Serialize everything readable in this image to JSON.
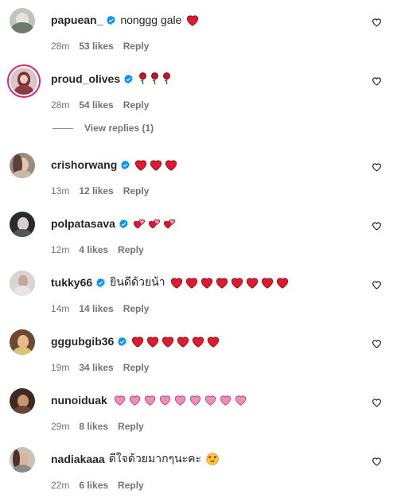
{
  "comments": [
    {
      "username": "papuean_",
      "verified": true,
      "text": "nonggg gale",
      "emoji": [
        {
          "type": "heart",
          "count": 1
        }
      ],
      "time": "28m",
      "likes": "53 likes",
      "reply": "Reply"
    },
    {
      "username": "proud_olives",
      "verified": true,
      "text": "",
      "emoji": [
        {
          "type": "rose",
          "count": 3
        }
      ],
      "time": "28m",
      "likes": "54 likes",
      "reply": "Reply",
      "story_ring": true,
      "view_replies": "View replies (1)"
    },
    {
      "username": "crishorwang",
      "verified": true,
      "text": "",
      "emoji": [
        {
          "type": "heart",
          "count": 3
        }
      ],
      "time": "13m",
      "likes": "12 likes",
      "reply": "Reply"
    },
    {
      "username": "polpatasava",
      "verified": true,
      "text": "",
      "emoji": [
        {
          "type": "two-hearts",
          "count": 3
        }
      ],
      "time": "12m",
      "likes": "4 likes",
      "reply": "Reply"
    },
    {
      "username": "tukky66",
      "verified": true,
      "text": "ยินดีด้วยน้า",
      "emoji": [
        {
          "type": "heart",
          "count": 8
        }
      ],
      "time": "14m",
      "likes": "14 likes",
      "reply": "Reply"
    },
    {
      "username": "gggubgib36",
      "verified": true,
      "text": "",
      "emoji": [
        {
          "type": "heart",
          "count": 6
        }
      ],
      "time": "19m",
      "likes": "34 likes",
      "reply": "Reply"
    },
    {
      "username": "nunoiduak",
      "verified": false,
      "text": "",
      "emoji": [
        {
          "type": "pink-heart",
          "count": 9
        }
      ],
      "time": "29m",
      "likes": "8 likes",
      "reply": "Reply"
    },
    {
      "username": "nadiakaaa",
      "verified": false,
      "text": "ดีใจด้วยมากๆนะคะ",
      "emoji": [
        {
          "type": "heart-eyes",
          "count": 1
        }
      ],
      "time": "22m",
      "likes": "6 likes",
      "reply": "Reply"
    }
  ],
  "colors": {
    "heart_red": "#e0192e",
    "heart_pink": "#f08eb6",
    "verified_blue": "#0095f6",
    "muted_text": "#737373",
    "story_ring": "#d62976"
  },
  "icons": {
    "verified": "verified-badge-icon",
    "like": "heart-outline-icon"
  }
}
